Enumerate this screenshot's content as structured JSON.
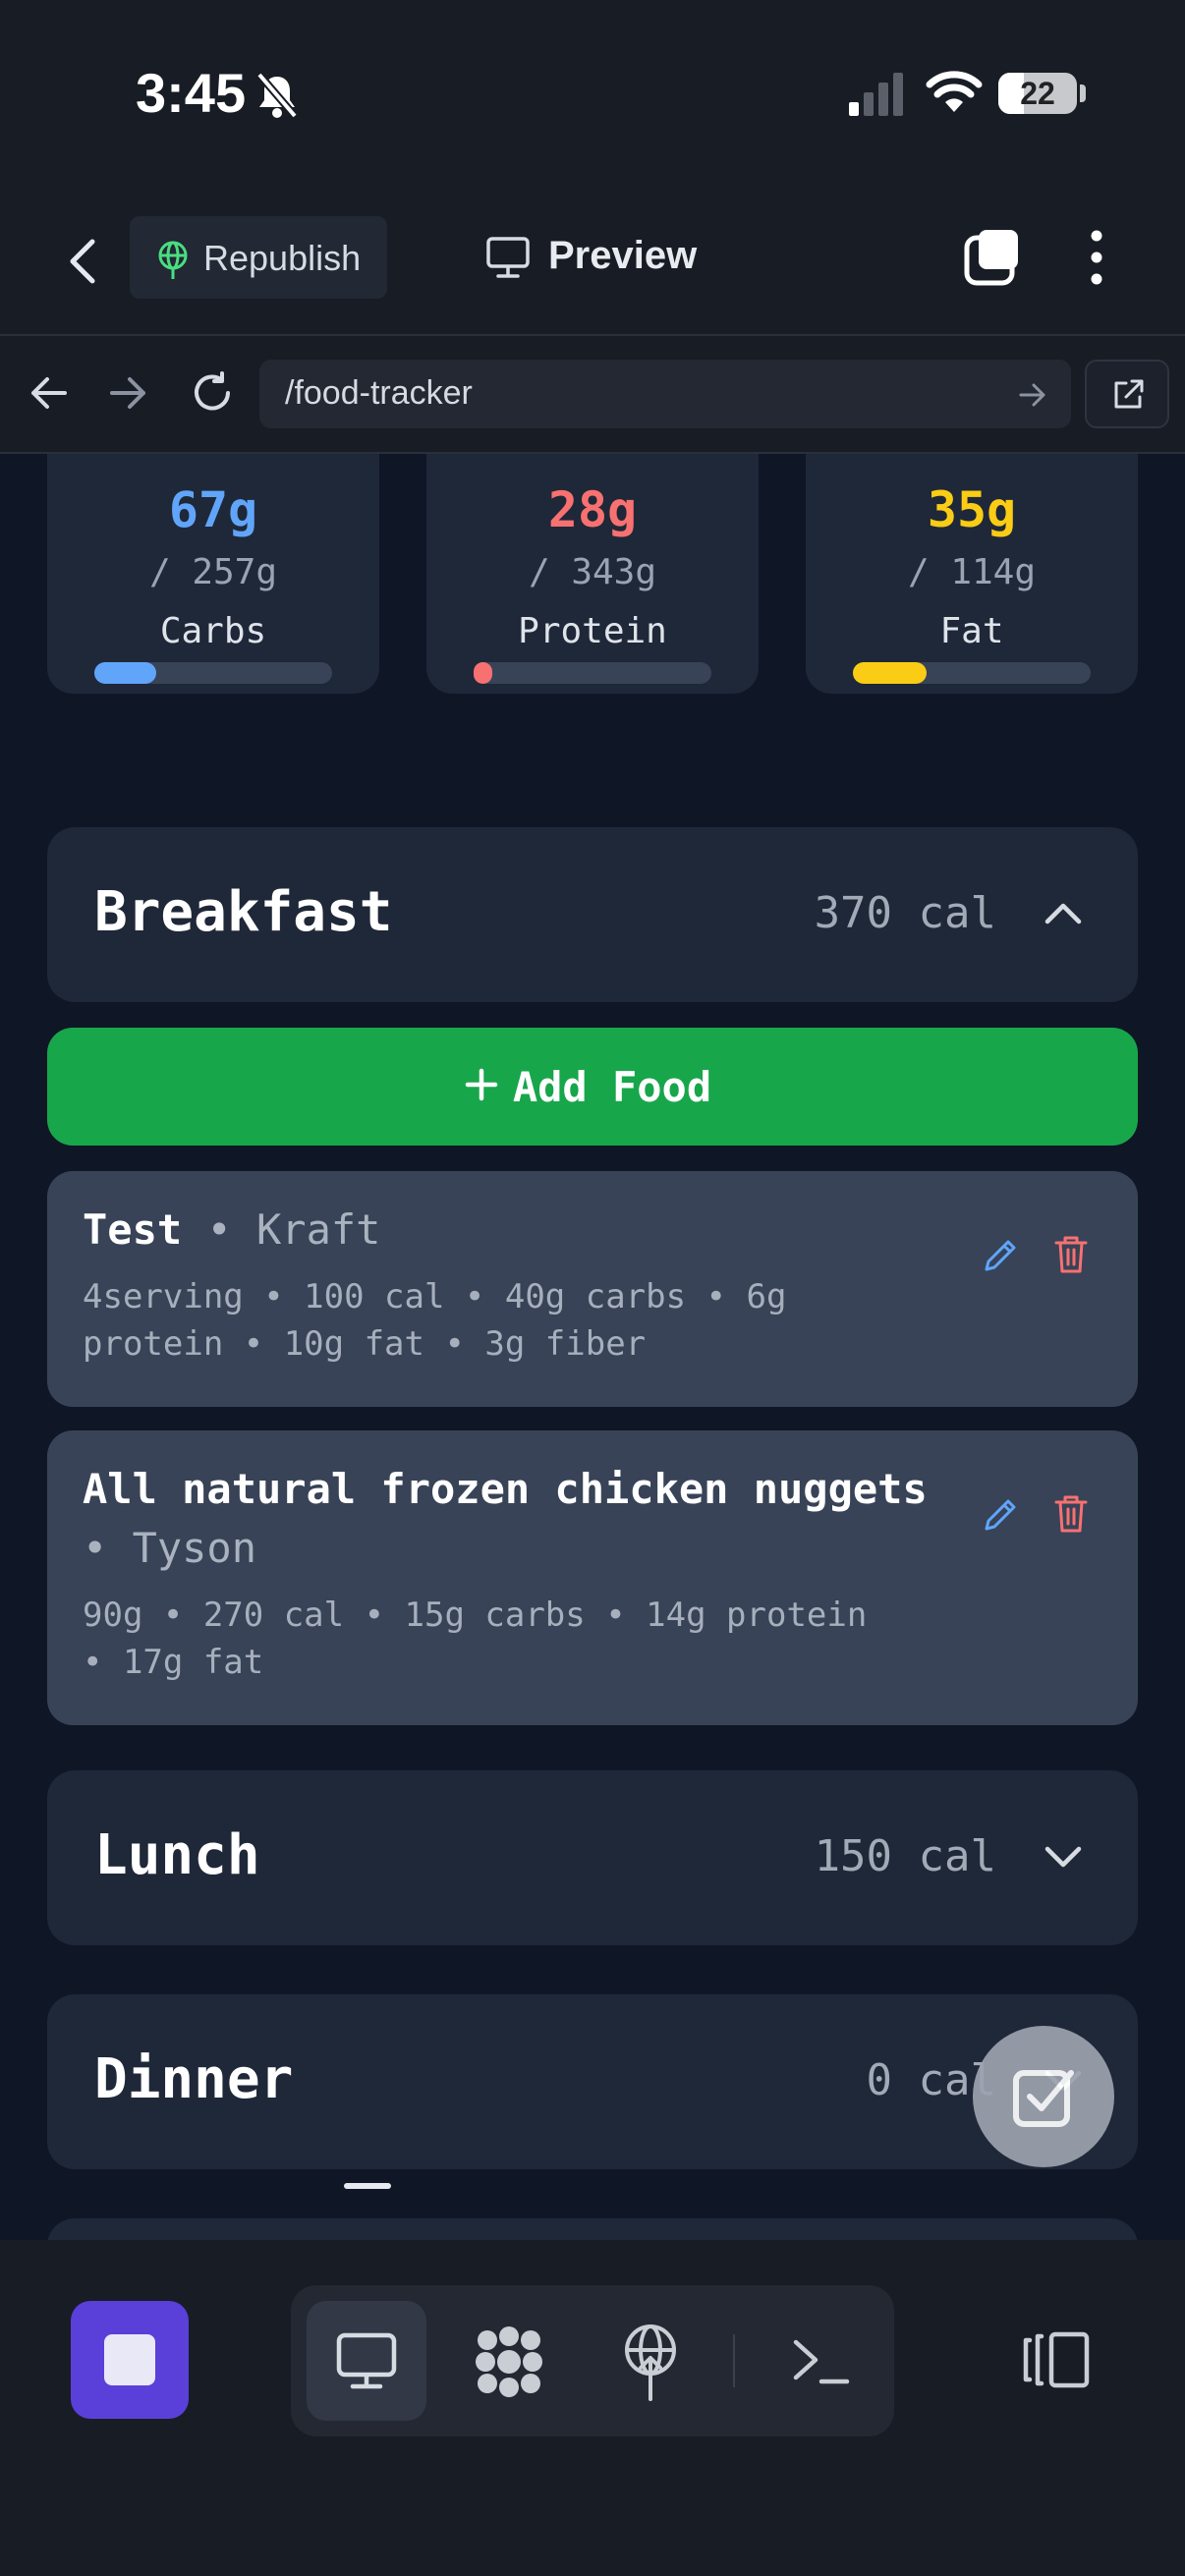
{
  "status_bar": {
    "time": "3:45",
    "battery": "22",
    "icons": [
      "bell-slash-icon",
      "signal-icon",
      "wifi-icon",
      "battery-icon"
    ]
  },
  "app_bar": {
    "republish_label": "Republish",
    "preview_label": "Preview",
    "icons": [
      "chevron-left-icon",
      "globe-icon",
      "monitor-icon",
      "tabs-icon",
      "more-vertical-icon"
    ]
  },
  "url_bar": {
    "url": "/food-tracker",
    "icons": [
      "arrow-left-icon",
      "arrow-right-icon",
      "reload-icon",
      "go-arrow-icon",
      "external-link-icon"
    ]
  },
  "macros": [
    {
      "value": "67g",
      "goal": "/ 257g",
      "label": "Carbs",
      "progress": 0.26,
      "color": "#60a5fa"
    },
    {
      "value": "28g",
      "goal": "/ 343g",
      "label": "Protein",
      "progress": 0.08,
      "color": "#f87171"
    },
    {
      "value": "35g",
      "goal": "/ 114g",
      "label": "Fat",
      "progress": 0.31,
      "color": "#facc15"
    }
  ],
  "meals": {
    "breakfast": {
      "name": "Breakfast",
      "calories": "370 cal",
      "expanded": true
    },
    "lunch": {
      "name": "Lunch",
      "calories": "150 cal",
      "expanded": false
    },
    "dinner": {
      "name": "Dinner",
      "calories": "0 cal",
      "expanded": false
    }
  },
  "add_food_label": "Add Food",
  "foods": [
    {
      "name": "Test",
      "brand": "• Kraft",
      "details_line1": "4serving • 100 cal • 40g carbs • 6g",
      "details_line2": "protein • 10g fat • 3g fiber"
    },
    {
      "name": "All natural frozen chicken nuggets",
      "brand": "• Tyson",
      "details_line1": "90g • 270 cal • 15g carbs • 14g protein",
      "details_line2": "• 17g fat"
    }
  ],
  "colors": {
    "accent_green": "#18a64b",
    "edit_blue": "#60a5fa",
    "delete_red": "#f87171",
    "stop_purple": "#5a3fd9"
  },
  "bottom_toolbar": {
    "icons": [
      "stop-icon",
      "monitor-icon",
      "nodes-icon",
      "deploy-icon",
      "terminal-icon",
      "panels-icon"
    ],
    "active_tool": "monitor-icon"
  }
}
